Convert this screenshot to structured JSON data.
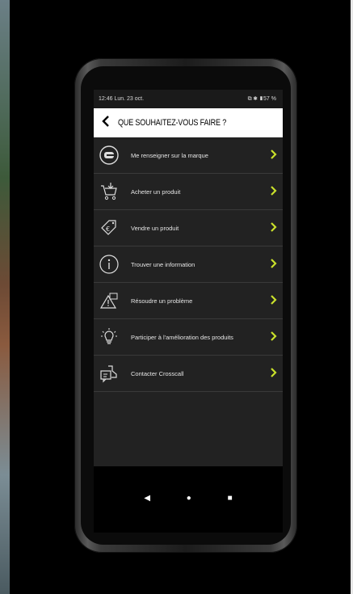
{
  "status_bar": {
    "time": "12:46 Lun. 23 oct.",
    "icons": "⧉ ✱ ▮57 %"
  },
  "header": {
    "back_icon": "chevron-left-icon",
    "title": "QUE SOUHAITEZ-VOUS FAIRE ?"
  },
  "menu": {
    "items": [
      {
        "label": "Me renseigner sur la marque",
        "icon": "crosscall-logo-icon"
      },
      {
        "label": "Acheter un produit",
        "icon": "cart-icon"
      },
      {
        "label": "Vendre un produit",
        "icon": "euro-tag-icon"
      },
      {
        "label": "Trouver une information",
        "icon": "info-icon"
      },
      {
        "label": "Résoudre un problème",
        "icon": "warning-icon"
      },
      {
        "label": "Participer à l'amélioration des produits",
        "icon": "lightbulb-icon"
      },
      {
        "label": "Contacter Crosscall",
        "icon": "contact-icon"
      }
    ],
    "chevron_color": "#c9e02b"
  },
  "nav": {
    "back": "◀",
    "home": "●",
    "recents": "■"
  }
}
